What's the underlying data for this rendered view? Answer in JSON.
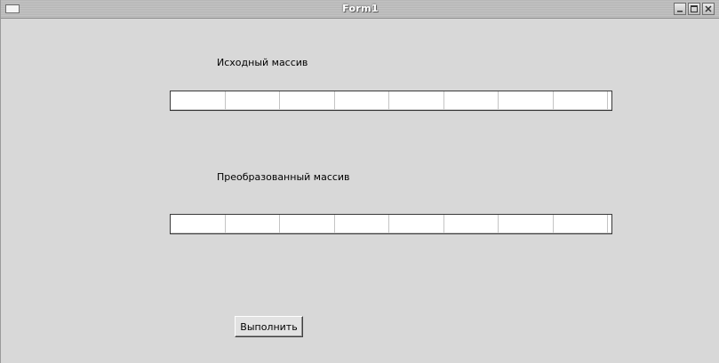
{
  "window": {
    "title": "Form1"
  },
  "labels": {
    "source_array": "Исходный массив",
    "transformed_array": "Преобразованный массив"
  },
  "source_grid": {
    "cells": [
      "",
      "",
      "",
      "",
      "",
      "",
      "",
      ""
    ]
  },
  "result_grid": {
    "cells": [
      "",
      "",
      "",
      "",
      "",
      "",
      "",
      ""
    ]
  },
  "actions": {
    "run_label": "Выполнить"
  },
  "icons": {
    "app": "window-icon",
    "minimize": "minimize-icon",
    "maximize": "maximize-icon",
    "close": "close-icon"
  }
}
